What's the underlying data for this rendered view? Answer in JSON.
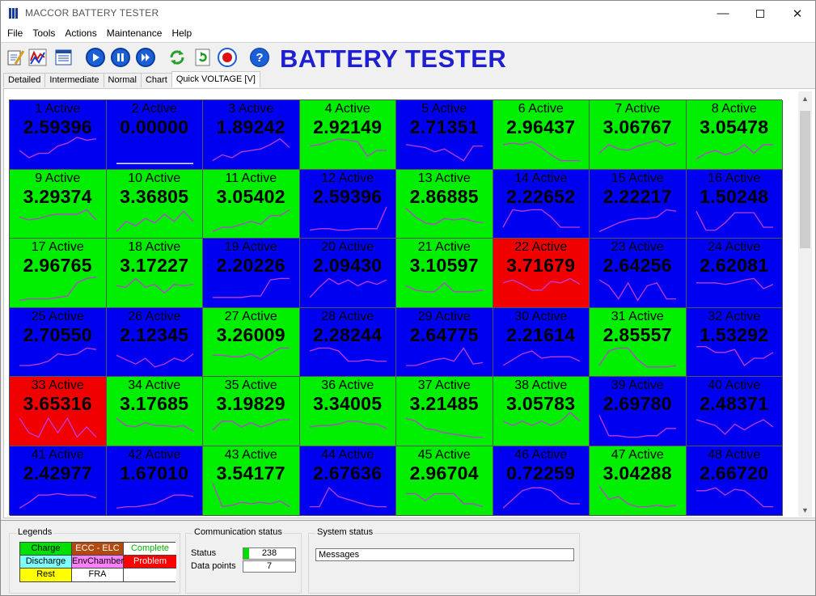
{
  "window": {
    "title": "MACCOR    BATTERY TESTER"
  },
  "menu": [
    "File",
    "Tools",
    "Actions",
    "Maintenance",
    "Help"
  ],
  "toolbar": {
    "heading": "BATTERY TESTER",
    "buttons": [
      "edit-icon",
      "graph-icon",
      "list-icon",
      "play-icon",
      "pause-icon",
      "step-icon",
      "recycle-icon",
      "refresh-icon",
      "record-icon",
      "help-icon"
    ]
  },
  "tabs": [
    "Detailed",
    "Intermediate",
    "Normal",
    "Chart",
    "Quick VOLTAGE [V]"
  ],
  "active_tab": "Quick VOLTAGE [V]",
  "colors": {
    "blue": "#0000f0",
    "green": "#00ee00",
    "red": "#f00000",
    "trace": "#c03cd8"
  },
  "channels": [
    {
      "label": "1 Active",
      "value": "2.59396",
      "state": "blue",
      "trace": [
        0.5,
        0.75,
        0.6,
        0.6,
        0.35,
        0.25,
        0.05,
        0.15,
        0.1
      ]
    },
    {
      "label": "2 Active",
      "value": "0.00000",
      "state": "blue",
      "trace": [
        0.95,
        0.95,
        0.95,
        0.95,
        0.95,
        0.95,
        0.95,
        0.95,
        0.95
      ]
    },
    {
      "label": "3 Active",
      "value": "1.89242",
      "state": "blue",
      "trace": [
        0.85,
        0.65,
        0.75,
        0.55,
        0.5,
        0.45,
        0.3,
        0.1,
        0.4
      ]
    },
    {
      "label": "4 Active",
      "value": "2.92149",
      "state": "green",
      "trace": [
        0.35,
        0.3,
        0.2,
        0.1,
        0.15,
        0.2,
        0.7,
        0.5,
        0.5
      ]
    },
    {
      "label": "5 Active",
      "value": "2.71351",
      "state": "blue",
      "trace": [
        0.3,
        0.35,
        0.4,
        0.55,
        0.45,
        0.65,
        0.85,
        0.35,
        0.35
      ]
    },
    {
      "label": "6 Active",
      "value": "2.96437",
      "state": "green",
      "trace": [
        0.3,
        0.25,
        0.3,
        0.2,
        0.4,
        0.65,
        0.85,
        0.85,
        0.85
      ]
    },
    {
      "label": "7 Active",
      "value": "3.06767",
      "state": "green",
      "trace": [
        0.6,
        0.3,
        0.45,
        0.5,
        0.35,
        0.25,
        0.15,
        0.35,
        0.25
      ]
    },
    {
      "label": "8 Active",
      "value": "3.05478",
      "state": "green",
      "trace": [
        0.8,
        0.6,
        0.5,
        0.65,
        0.55,
        0.3,
        0.6,
        0.3,
        0.3
      ]
    },
    {
      "label": "9 Active",
      "value": "3.29374",
      "state": "green",
      "trace": [
        0.4,
        0.5,
        0.45,
        0.35,
        0.3,
        0.3,
        0.3,
        0.15,
        0.5
      ]
    },
    {
      "label": "10 Active",
      "value": "3.36805",
      "state": "green",
      "trace": [
        0.9,
        0.55,
        0.7,
        0.45,
        0.6,
        0.3,
        0.55,
        0.2,
        0.55
      ]
    },
    {
      "label": "11 Active",
      "value": "3.05402",
      "state": "green",
      "trace": [
        0.9,
        0.75,
        0.75,
        0.65,
        0.55,
        0.65,
        0.35,
        0.35,
        0.15
      ]
    },
    {
      "label": "12 Active",
      "value": "2.59396",
      "state": "blue",
      "trace": [
        0.85,
        0.8,
        0.8,
        0.85,
        0.85,
        0.8,
        0.8,
        0.8,
        0.05
      ]
    },
    {
      "label": "13 Active",
      "value": "2.86885",
      "state": "green",
      "trace": [
        0.1,
        0.4,
        0.6,
        0.65,
        0.45,
        0.5,
        0.45,
        0.55,
        0.6
      ]
    },
    {
      "label": "14 Active",
      "value": "2.22652",
      "state": "blue",
      "trace": [
        0.75,
        0.15,
        0.2,
        0.15,
        0.15,
        0.4,
        0.75,
        0.75,
        0.75
      ]
    },
    {
      "label": "15 Active",
      "value": "2.22217",
      "state": "blue",
      "trace": [
        0.9,
        0.75,
        0.6,
        0.5,
        0.45,
        0.45,
        0.4,
        0.15,
        0.2
      ]
    },
    {
      "label": "16 Active",
      "value": "1.50248",
      "state": "blue",
      "trace": [
        0.2,
        0.85,
        0.85,
        0.6,
        0.25,
        0.25,
        0.25,
        0.75,
        0.75
      ]
    },
    {
      "label": "17 Active",
      "value": "2.96765",
      "state": "green",
      "trace": [
        0.9,
        0.85,
        0.85,
        0.85,
        0.8,
        0.75,
        0.3,
        0.15,
        0.1
      ]
    },
    {
      "label": "18 Active",
      "value": "3.17227",
      "state": "green",
      "trace": [
        0.4,
        0.45,
        0.15,
        0.45,
        0.35,
        0.65,
        0.35,
        0.4,
        0.35
      ]
    },
    {
      "label": "19 Active",
      "value": "2.20226",
      "state": "blue",
      "trace": [
        0.8,
        0.8,
        0.8,
        0.8,
        0.75,
        0.75,
        0.2,
        0.15,
        0.15
      ]
    },
    {
      "label": "20 Active",
      "value": "2.09430",
      "state": "blue",
      "trace": [
        0.8,
        0.45,
        0.15,
        0.35,
        0.2,
        0.4,
        0.25,
        0.35,
        0.2
      ]
    },
    {
      "label": "21 Active",
      "value": "3.10597",
      "state": "green",
      "trace": [
        0.4,
        0.55,
        0.6,
        0.6,
        0.3,
        0.6,
        0.6,
        0.6,
        0.55
      ]
    },
    {
      "label": "22 Active",
      "value": "3.71679",
      "state": "red",
      "trace": [
        0.3,
        0.2,
        0.35,
        0.55,
        0.55,
        0.25,
        0.3,
        0.15,
        0.35
      ]
    },
    {
      "label": "23 Active",
      "value": "2.64256",
      "state": "blue",
      "trace": [
        0.2,
        0.4,
        0.85,
        0.3,
        0.9,
        0.4,
        0.3,
        0.85,
        0.85
      ]
    },
    {
      "label": "24 Active",
      "value": "2.62081",
      "state": "blue",
      "trace": [
        0.3,
        0.3,
        0.3,
        0.35,
        0.3,
        0.2,
        0.15,
        0.5,
        0.35
      ]
    },
    {
      "label": "25 Active",
      "value": "2.70550",
      "state": "blue",
      "trace": [
        0.75,
        0.75,
        0.7,
        0.6,
        0.35,
        0.4,
        0.35,
        0.15,
        0.2
      ]
    },
    {
      "label": "26 Active",
      "value": "2.12345",
      "state": "blue",
      "trace": [
        0.4,
        0.55,
        0.7,
        0.5,
        0.8,
        0.7,
        0.5,
        0.6,
        0.35
      ]
    },
    {
      "label": "27 Active",
      "value": "3.26009",
      "state": "green",
      "trace": [
        0.4,
        0.4,
        0.45,
        0.45,
        0.35,
        0.55,
        0.35,
        0.15,
        0.15
      ]
    },
    {
      "label": "28 Active",
      "value": "2.28244",
      "state": "blue",
      "trace": [
        0.25,
        0.15,
        0.15,
        0.25,
        0.6,
        0.6,
        0.55,
        0.6,
        0.6
      ]
    },
    {
      "label": "29 Active",
      "value": "2.64775",
      "state": "blue",
      "trace": [
        0.75,
        0.75,
        0.65,
        0.55,
        0.5,
        0.6,
        0.15,
        0.7,
        0.65
      ]
    },
    {
      "label": "30 Active",
      "value": "2.21614",
      "state": "blue",
      "trace": [
        0.75,
        0.55,
        0.35,
        0.25,
        0.5,
        0.45,
        0.45,
        0.45,
        0.6
      ]
    },
    {
      "label": "31 Active",
      "value": "2.85557",
      "state": "green",
      "trace": [
        0.75,
        0.25,
        0.15,
        0.15,
        0.55,
        0.8,
        0.8,
        0.8,
        0.75
      ]
    },
    {
      "label": "32 Active",
      "value": "1.53292",
      "state": "blue",
      "trace": [
        0.1,
        0.1,
        0.3,
        0.3,
        0.2,
        0.75,
        0.5,
        0.5,
        0.3
      ]
    },
    {
      "label": "33 Active",
      "value": "3.65316",
      "state": "red",
      "trace": [
        0.2,
        0.7,
        0.85,
        0.2,
        0.7,
        0.2,
        0.85,
        0.5,
        0.85
      ]
    },
    {
      "label": "34 Active",
      "value": "3.17685",
      "state": "green",
      "trace": [
        0.2,
        0.45,
        0.5,
        0.35,
        0.45,
        0.45,
        0.5,
        0.45,
        0.65
      ]
    },
    {
      "label": "35 Active",
      "value": "3.19829",
      "state": "green",
      "trace": [
        0.6,
        0.3,
        0.3,
        0.5,
        0.35,
        0.5,
        0.4,
        0.25,
        0.25
      ]
    },
    {
      "label": "36 Active",
      "value": "3.34005",
      "state": "green",
      "trace": [
        0.5,
        0.45,
        0.45,
        0.4,
        0.3,
        0.3,
        0.4,
        0.4,
        0.55
      ]
    },
    {
      "label": "37 Active",
      "value": "3.21485",
      "state": "green",
      "trace": [
        0.2,
        0.3,
        0.55,
        0.6,
        0.7,
        0.75,
        0.8,
        0.85,
        0.85
      ]
    },
    {
      "label": "38 Active",
      "value": "3.05783",
      "state": "green",
      "trace": [
        0.3,
        0.45,
        0.3,
        0.45,
        0.3,
        0.45,
        0.3,
        0.0,
        0.3
      ]
    },
    {
      "label": "39 Active",
      "value": "2.69780",
      "state": "blue",
      "trace": [
        0.1,
        0.8,
        0.8,
        0.85,
        0.85,
        0.8,
        0.8,
        0.55,
        0.55
      ]
    },
    {
      "label": "40 Active",
      "value": "2.48371",
      "state": "blue",
      "trace": [
        0.25,
        0.35,
        0.45,
        0.75,
        0.4,
        0.6,
        0.4,
        0.25,
        0.5
      ]
    },
    {
      "label": "41 Active",
      "value": "2.42977",
      "state": "blue",
      "trace": [
        0.9,
        0.7,
        0.45,
        0.45,
        0.4,
        0.45,
        0.45,
        0.45,
        0.55
      ]
    },
    {
      "label": "42 Active",
      "value": "1.67010",
      "state": "blue",
      "trace": [
        0.9,
        0.85,
        0.85,
        0.8,
        0.75,
        0.6,
        0.45,
        0.45,
        0.5
      ]
    },
    {
      "label": "43 Active",
      "value": "3.54177",
      "state": "green",
      "trace": [
        0.05,
        0.85,
        0.8,
        0.7,
        0.75,
        0.7,
        0.75,
        0.65,
        0.85
      ]
    },
    {
      "label": "44 Active",
      "value": "2.67636",
      "state": "blue",
      "trace": [
        0.85,
        0.85,
        0.2,
        0.5,
        0.6,
        0.7,
        0.8,
        0.85,
        0.85
      ]
    },
    {
      "label": "45 Active",
      "value": "2.96704",
      "state": "green",
      "trace": [
        0.4,
        0.4,
        0.65,
        0.4,
        0.4,
        0.4,
        0.75,
        0.75,
        0.85
      ]
    },
    {
      "label": "46 Active",
      "value": "0.72259",
      "state": "blue",
      "trace": [
        0.9,
        0.6,
        0.3,
        0.2,
        0.2,
        0.3,
        0.6,
        0.75,
        0.75
      ]
    },
    {
      "label": "47 Active",
      "value": "3.04288",
      "state": "green",
      "trace": [
        0.15,
        0.6,
        0.5,
        0.75,
        0.85,
        0.85,
        0.8,
        0.85,
        0.8
      ]
    },
    {
      "label": "48 Active",
      "value": "2.66720",
      "state": "blue",
      "trace": [
        0.3,
        0.3,
        0.2,
        0.45,
        0.25,
        0.3,
        0.55,
        0.85,
        0.85
      ]
    }
  ],
  "legends": {
    "title": "Legends",
    "items": [
      {
        "label": "Charge",
        "bg": "#00e000",
        "fg": "#000000"
      },
      {
        "label": "ECC - ELC",
        "bg": "#b04a10",
        "fg": "#ffffff"
      },
      {
        "label": "Complete",
        "bg": "#ffffff",
        "fg": "#00b000"
      },
      {
        "label": "Discharge",
        "bg": "#80ffff",
        "fg": "#000000"
      },
      {
        "label": "EnvChamber",
        "bg": "#ff80ff",
        "fg": "#000000"
      },
      {
        "label": "Problem",
        "bg": "#ff0000",
        "fg": "#ffffff"
      },
      {
        "label": "Rest",
        "bg": "#ffff00",
        "fg": "#000000"
      },
      {
        "label": "FRA",
        "bg": "#ffffff",
        "fg": "#000000"
      },
      {
        "label": "",
        "bg": "#ffffff",
        "fg": "#000000"
      }
    ]
  },
  "communication": {
    "title": "Communication status",
    "status_label": "Status",
    "status_value": "238",
    "points_label": "Data points",
    "points_value": "7"
  },
  "system": {
    "title": "System status",
    "messages": "Messages"
  }
}
